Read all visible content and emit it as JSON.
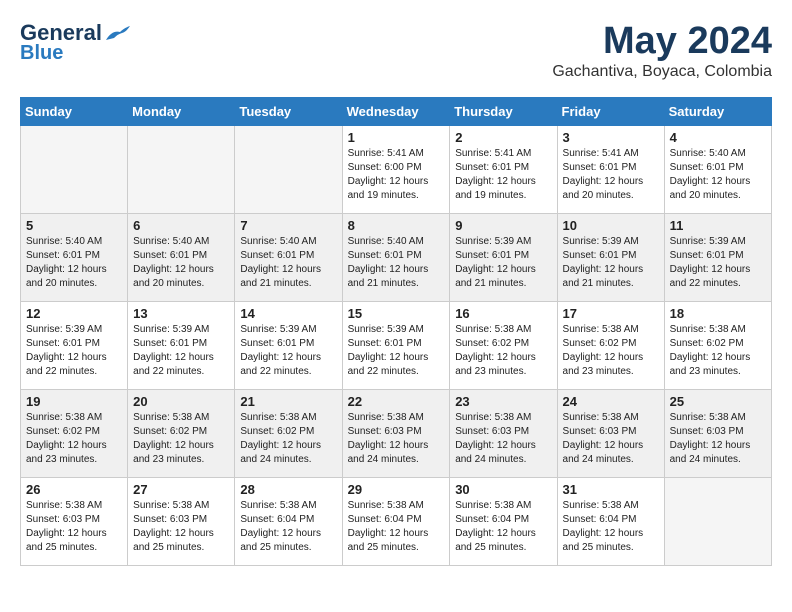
{
  "header": {
    "logo_general": "General",
    "logo_blue": "Blue",
    "month_title": "May 2024",
    "location": "Gachantiva, Boyaca, Colombia"
  },
  "weekdays": [
    "Sunday",
    "Monday",
    "Tuesday",
    "Wednesday",
    "Thursday",
    "Friday",
    "Saturday"
  ],
  "weeks": [
    [
      {
        "day": "",
        "info": "",
        "empty": true
      },
      {
        "day": "",
        "info": "",
        "empty": true
      },
      {
        "day": "",
        "info": "",
        "empty": true
      },
      {
        "day": "1",
        "info": "Sunrise: 5:41 AM\nSunset: 6:00 PM\nDaylight: 12 hours\nand 19 minutes."
      },
      {
        "day": "2",
        "info": "Sunrise: 5:41 AM\nSunset: 6:01 PM\nDaylight: 12 hours\nand 19 minutes."
      },
      {
        "day": "3",
        "info": "Sunrise: 5:41 AM\nSunset: 6:01 PM\nDaylight: 12 hours\nand 20 minutes."
      },
      {
        "day": "4",
        "info": "Sunrise: 5:40 AM\nSunset: 6:01 PM\nDaylight: 12 hours\nand 20 minutes."
      }
    ],
    [
      {
        "day": "5",
        "info": "Sunrise: 5:40 AM\nSunset: 6:01 PM\nDaylight: 12 hours\nand 20 minutes."
      },
      {
        "day": "6",
        "info": "Sunrise: 5:40 AM\nSunset: 6:01 PM\nDaylight: 12 hours\nand 20 minutes."
      },
      {
        "day": "7",
        "info": "Sunrise: 5:40 AM\nSunset: 6:01 PM\nDaylight: 12 hours\nand 21 minutes."
      },
      {
        "day": "8",
        "info": "Sunrise: 5:40 AM\nSunset: 6:01 PM\nDaylight: 12 hours\nand 21 minutes."
      },
      {
        "day": "9",
        "info": "Sunrise: 5:39 AM\nSunset: 6:01 PM\nDaylight: 12 hours\nand 21 minutes."
      },
      {
        "day": "10",
        "info": "Sunrise: 5:39 AM\nSunset: 6:01 PM\nDaylight: 12 hours\nand 21 minutes."
      },
      {
        "day": "11",
        "info": "Sunrise: 5:39 AM\nSunset: 6:01 PM\nDaylight: 12 hours\nand 22 minutes."
      }
    ],
    [
      {
        "day": "12",
        "info": "Sunrise: 5:39 AM\nSunset: 6:01 PM\nDaylight: 12 hours\nand 22 minutes."
      },
      {
        "day": "13",
        "info": "Sunrise: 5:39 AM\nSunset: 6:01 PM\nDaylight: 12 hours\nand 22 minutes."
      },
      {
        "day": "14",
        "info": "Sunrise: 5:39 AM\nSunset: 6:01 PM\nDaylight: 12 hours\nand 22 minutes."
      },
      {
        "day": "15",
        "info": "Sunrise: 5:39 AM\nSunset: 6:01 PM\nDaylight: 12 hours\nand 22 minutes."
      },
      {
        "day": "16",
        "info": "Sunrise: 5:38 AM\nSunset: 6:02 PM\nDaylight: 12 hours\nand 23 minutes."
      },
      {
        "day": "17",
        "info": "Sunrise: 5:38 AM\nSunset: 6:02 PM\nDaylight: 12 hours\nand 23 minutes."
      },
      {
        "day": "18",
        "info": "Sunrise: 5:38 AM\nSunset: 6:02 PM\nDaylight: 12 hours\nand 23 minutes."
      }
    ],
    [
      {
        "day": "19",
        "info": "Sunrise: 5:38 AM\nSunset: 6:02 PM\nDaylight: 12 hours\nand 23 minutes."
      },
      {
        "day": "20",
        "info": "Sunrise: 5:38 AM\nSunset: 6:02 PM\nDaylight: 12 hours\nand 23 minutes."
      },
      {
        "day": "21",
        "info": "Sunrise: 5:38 AM\nSunset: 6:02 PM\nDaylight: 12 hours\nand 24 minutes."
      },
      {
        "day": "22",
        "info": "Sunrise: 5:38 AM\nSunset: 6:03 PM\nDaylight: 12 hours\nand 24 minutes."
      },
      {
        "day": "23",
        "info": "Sunrise: 5:38 AM\nSunset: 6:03 PM\nDaylight: 12 hours\nand 24 minutes."
      },
      {
        "day": "24",
        "info": "Sunrise: 5:38 AM\nSunset: 6:03 PM\nDaylight: 12 hours\nand 24 minutes."
      },
      {
        "day": "25",
        "info": "Sunrise: 5:38 AM\nSunset: 6:03 PM\nDaylight: 12 hours\nand 24 minutes."
      }
    ],
    [
      {
        "day": "26",
        "info": "Sunrise: 5:38 AM\nSunset: 6:03 PM\nDaylight: 12 hours\nand 25 minutes."
      },
      {
        "day": "27",
        "info": "Sunrise: 5:38 AM\nSunset: 6:03 PM\nDaylight: 12 hours\nand 25 minutes."
      },
      {
        "day": "28",
        "info": "Sunrise: 5:38 AM\nSunset: 6:04 PM\nDaylight: 12 hours\nand 25 minutes."
      },
      {
        "day": "29",
        "info": "Sunrise: 5:38 AM\nSunset: 6:04 PM\nDaylight: 12 hours\nand 25 minutes."
      },
      {
        "day": "30",
        "info": "Sunrise: 5:38 AM\nSunset: 6:04 PM\nDaylight: 12 hours\nand 25 minutes."
      },
      {
        "day": "31",
        "info": "Sunrise: 5:38 AM\nSunset: 6:04 PM\nDaylight: 12 hours\nand 25 minutes."
      },
      {
        "day": "",
        "info": "",
        "empty": true
      }
    ]
  ]
}
